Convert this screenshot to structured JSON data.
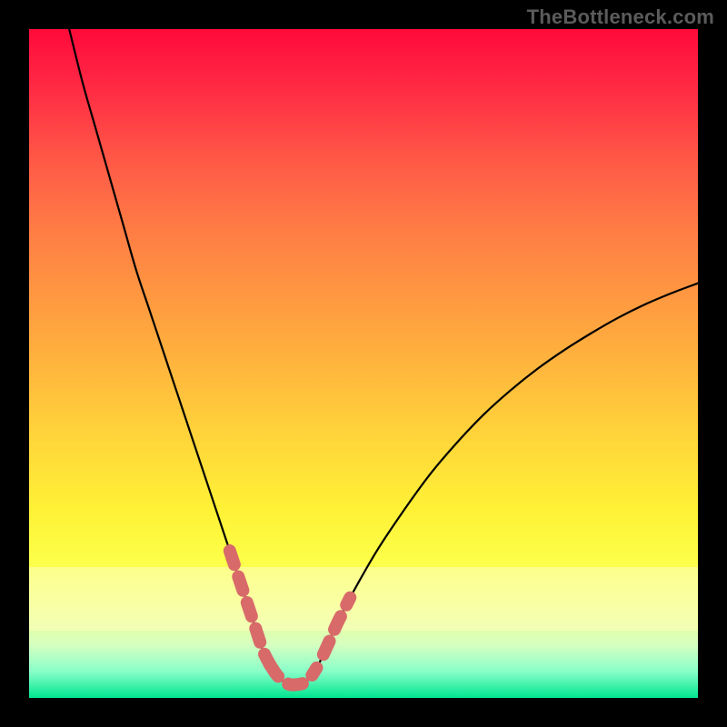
{
  "watermark": {
    "text": "TheBottleneck.com"
  },
  "chart_data": {
    "type": "line",
    "title": "",
    "xlabel": "",
    "ylabel": "",
    "xlim": [
      0,
      100
    ],
    "ylim": [
      0,
      100
    ],
    "grid": false,
    "legend": false,
    "series": [
      {
        "name": "bottleneck-curve",
        "color": "#000000",
        "x": [
          6,
          8,
          10,
          12,
          14,
          16,
          18,
          20,
          22,
          24,
          26,
          28,
          30,
          32,
          33,
          34,
          35,
          36,
          37,
          38,
          39,
          40,
          41,
          42,
          43,
          44,
          46,
          48,
          52,
          56,
          60,
          64,
          68,
          72,
          76,
          80,
          84,
          88,
          92,
          96,
          100
        ],
        "y": [
          100,
          92,
          85,
          78,
          71,
          64,
          58,
          52,
          46,
          40,
          34,
          28,
          22,
          16,
          13,
          10,
          7,
          5,
          3.5,
          2.5,
          2,
          2,
          2.2,
          3,
          4.5,
          6.5,
          11,
          15,
          22,
          28,
          33.5,
          38.2,
          42.4,
          46,
          49.2,
          52,
          54.5,
          56.8,
          58.8,
          60.5,
          62
        ]
      },
      {
        "name": "highlight-left",
        "color": "#d86a6a",
        "style": "dashed-thick",
        "x": [
          30,
          31,
          32,
          33,
          34,
          35,
          36
        ],
        "y": [
          22,
          19,
          16,
          13,
          10,
          7,
          5
        ]
      },
      {
        "name": "highlight-bottom",
        "color": "#d86a6a",
        "style": "dashed-thick",
        "x": [
          36,
          37,
          38,
          39,
          40,
          41,
          42,
          43
        ],
        "y": [
          5,
          3.5,
          2.5,
          2,
          2,
          2.2,
          3,
          4.5
        ]
      },
      {
        "name": "highlight-right",
        "color": "#d86a6a",
        "style": "dashed-thick",
        "x": [
          44,
          45,
          46,
          47,
          48
        ],
        "y": [
          6.5,
          8.7,
          11,
          13,
          15
        ]
      }
    ],
    "background_gradient_stops": [
      {
        "pos": 0,
        "color": "#ff0a3a"
      },
      {
        "pos": 20,
        "color": "#ff5a46"
      },
      {
        "pos": 45,
        "color": "#ffa63f"
      },
      {
        "pos": 72,
        "color": "#fff236"
      },
      {
        "pos": 86,
        "color": "#f2ff86"
      },
      {
        "pos": 100,
        "color": "#00e690"
      }
    ],
    "pale_band_y": [
      10,
      20
    ]
  }
}
